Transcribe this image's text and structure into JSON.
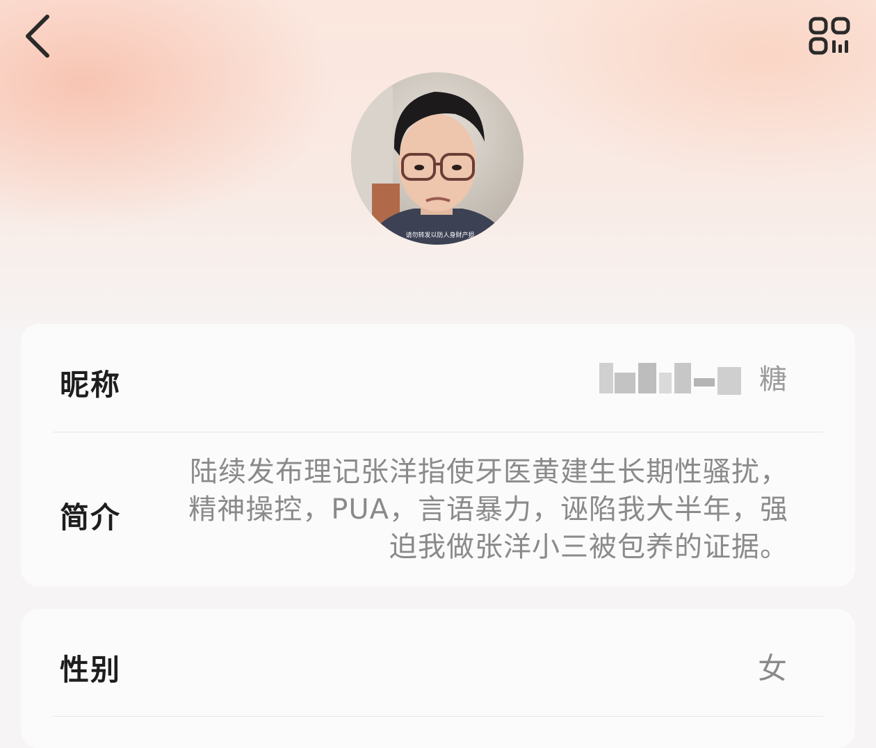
{
  "header": {
    "back_icon": "chevron-left-icon",
    "qr_icon": "qr-code-icon"
  },
  "profile": {
    "avatar_caption": "请勿转发以防人身财产损"
  },
  "fields": {
    "nickname": {
      "label": "昵称",
      "value_visible_part": "糖"
    },
    "bio": {
      "label": "简介",
      "value": "陆续发布理记张洋指使牙医黄建生长期性骚扰，精神操控，PUA，言语暴力，诬陷我大半年，强迫我做张洋小三被包养的证据。"
    },
    "gender": {
      "label": "性别",
      "value": "女"
    }
  }
}
